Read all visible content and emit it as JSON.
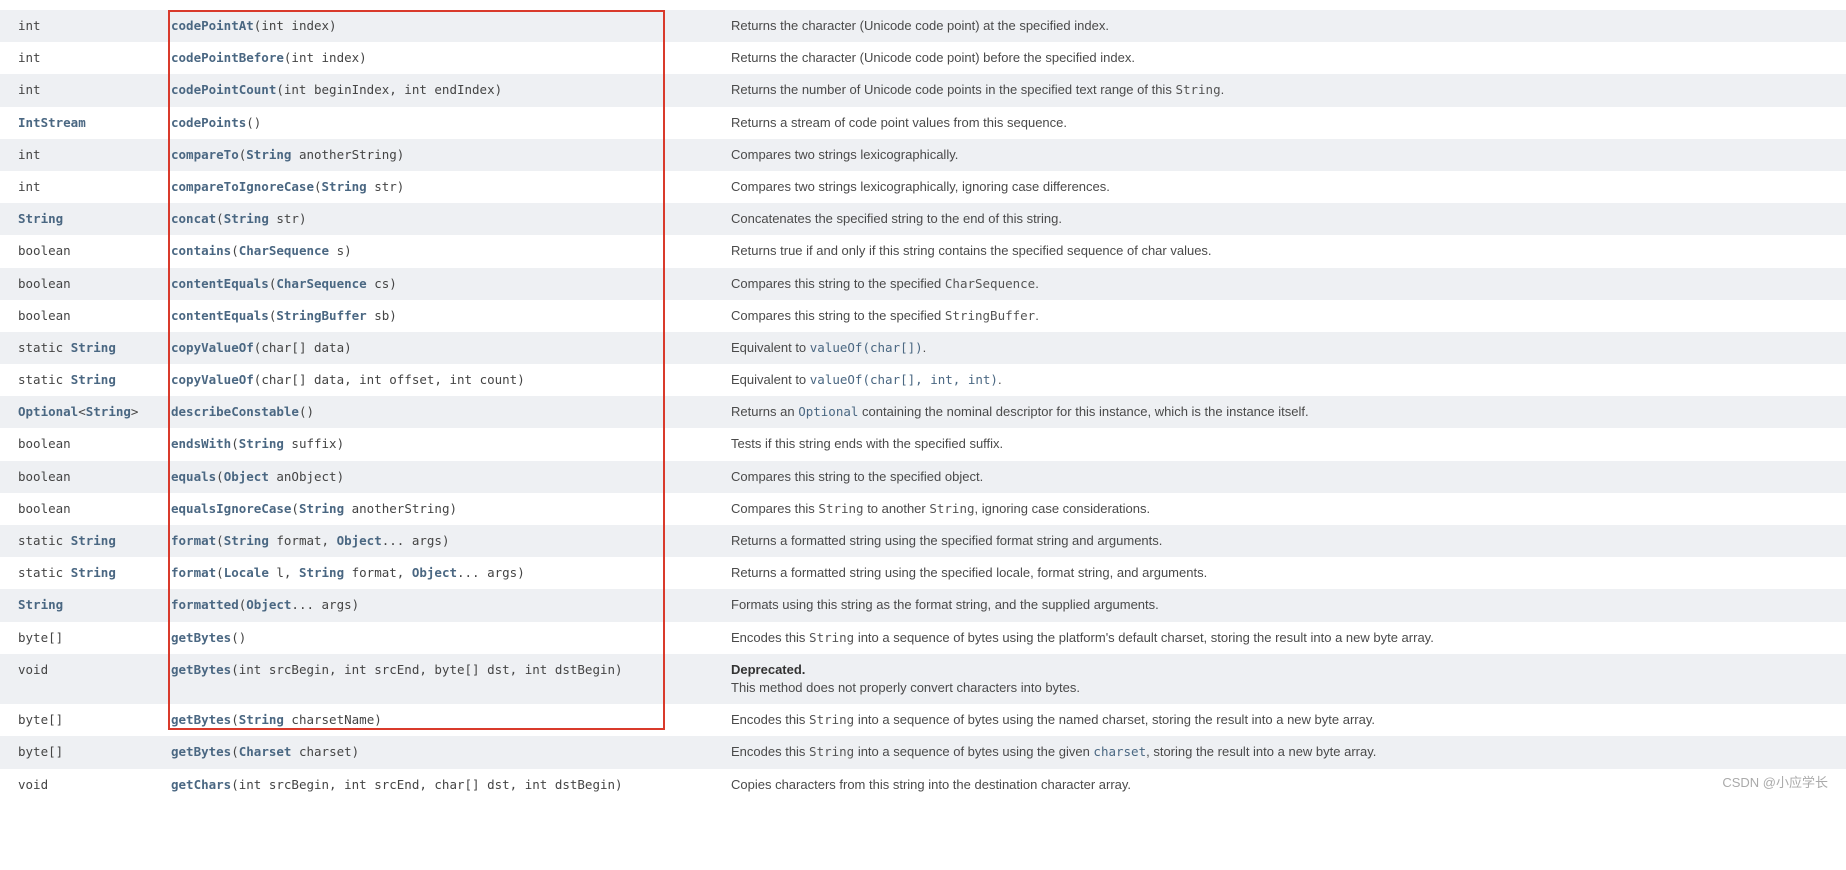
{
  "watermark": "CSDN @小应学长",
  "rows": [
    {
      "type": [
        {
          "t": "int"
        }
      ],
      "method": [
        {
          "l": "codePointAt"
        },
        {
          "t": "(int index)"
        }
      ],
      "desc": [
        {
          "t": "Returns the character (Unicode code point) at the specified index."
        }
      ]
    },
    {
      "type": [
        {
          "t": "int"
        }
      ],
      "method": [
        {
          "l": "codePointBefore"
        },
        {
          "t": "(int index)"
        }
      ],
      "desc": [
        {
          "t": "Returns the character (Unicode code point) before the specified index."
        }
      ]
    },
    {
      "type": [
        {
          "t": "int"
        }
      ],
      "method": [
        {
          "l": "codePointCount"
        },
        {
          "t": "(int beginIndex, int endIndex)"
        }
      ],
      "desc": [
        {
          "t": "Returns the number of Unicode code points in the specified text range of this "
        },
        {
          "c": "String"
        },
        {
          "t": "."
        }
      ]
    },
    {
      "type": [
        {
          "l": "IntStream"
        }
      ],
      "method": [
        {
          "l": "codePoints"
        },
        {
          "t": "()"
        }
      ],
      "desc": [
        {
          "t": "Returns a stream of code point values from this sequence."
        }
      ]
    },
    {
      "type": [
        {
          "t": "int"
        }
      ],
      "method": [
        {
          "l": "compareTo"
        },
        {
          "t": "("
        },
        {
          "l": "String"
        },
        {
          "t": " anotherString)"
        }
      ],
      "desc": [
        {
          "t": "Compares two strings lexicographically."
        }
      ]
    },
    {
      "type": [
        {
          "t": "int"
        }
      ],
      "method": [
        {
          "l": "compareToIgnoreCase"
        },
        {
          "t": "("
        },
        {
          "l": "String"
        },
        {
          "t": " str)"
        }
      ],
      "desc": [
        {
          "t": "Compares two strings lexicographically, ignoring case differences."
        }
      ]
    },
    {
      "type": [
        {
          "l": "String"
        }
      ],
      "method": [
        {
          "l": "concat"
        },
        {
          "t": "("
        },
        {
          "l": "String"
        },
        {
          "t": " str)"
        }
      ],
      "desc": [
        {
          "t": "Concatenates the specified string to the end of this string."
        }
      ]
    },
    {
      "type": [
        {
          "t": "boolean"
        }
      ],
      "method": [
        {
          "l": "contains"
        },
        {
          "t": "("
        },
        {
          "l": "CharSequence"
        },
        {
          "t": " s)"
        }
      ],
      "desc": [
        {
          "t": "Returns true if and only if this string contains the specified sequence of char values."
        }
      ]
    },
    {
      "type": [
        {
          "t": "boolean"
        }
      ],
      "method": [
        {
          "l": "contentEquals"
        },
        {
          "t": "("
        },
        {
          "l": "CharSequence"
        },
        {
          "t": " cs)"
        }
      ],
      "desc": [
        {
          "t": "Compares this string to the specified "
        },
        {
          "c": "CharSequence"
        },
        {
          "t": "."
        }
      ]
    },
    {
      "type": [
        {
          "t": "boolean"
        }
      ],
      "method": [
        {
          "l": "contentEquals"
        },
        {
          "t": "("
        },
        {
          "l": "StringBuffer"
        },
        {
          "t": " sb)"
        }
      ],
      "desc": [
        {
          "t": "Compares this string to the specified "
        },
        {
          "c": "StringBuffer"
        },
        {
          "t": "."
        }
      ]
    },
    {
      "type": [
        {
          "t": "static "
        },
        {
          "l": "String"
        }
      ],
      "method": [
        {
          "l": "copyValueOf"
        },
        {
          "t": "(char[] data)"
        }
      ],
      "desc": [
        {
          "t": "Equivalent to "
        },
        {
          "a": "valueOf(char[])"
        },
        {
          "t": "."
        }
      ]
    },
    {
      "type": [
        {
          "t": "static "
        },
        {
          "l": "String"
        }
      ],
      "method": [
        {
          "l": "copyValueOf"
        },
        {
          "t": "(char[] data, int offset, int count)"
        }
      ],
      "desc": [
        {
          "t": "Equivalent to "
        },
        {
          "a": "valueOf(char[], int, int)"
        },
        {
          "t": "."
        }
      ]
    },
    {
      "type": [
        {
          "l": "Optional"
        },
        {
          "t": "<"
        },
        {
          "l": "String"
        },
        {
          "t": ">"
        }
      ],
      "method": [
        {
          "l": "describeConstable"
        },
        {
          "t": "()"
        }
      ],
      "desc": [
        {
          "t": "Returns an "
        },
        {
          "a": "Optional"
        },
        {
          "t": " containing the nominal descriptor for this instance, which is the instance itself."
        }
      ]
    },
    {
      "type": [
        {
          "t": "boolean"
        }
      ],
      "method": [
        {
          "l": "endsWith"
        },
        {
          "t": "("
        },
        {
          "l": "String"
        },
        {
          "t": " suffix)"
        }
      ],
      "desc": [
        {
          "t": "Tests if this string ends with the specified suffix."
        }
      ]
    },
    {
      "type": [
        {
          "t": "boolean"
        }
      ],
      "method": [
        {
          "l": "equals"
        },
        {
          "t": "("
        },
        {
          "l": "Object"
        },
        {
          "t": " anObject)"
        }
      ],
      "desc": [
        {
          "t": "Compares this string to the specified object."
        }
      ]
    },
    {
      "type": [
        {
          "t": "boolean"
        }
      ],
      "method": [
        {
          "l": "equalsIgnoreCase"
        },
        {
          "t": "("
        },
        {
          "l": "String"
        },
        {
          "t": " anotherString)"
        }
      ],
      "desc": [
        {
          "t": "Compares this "
        },
        {
          "c": "String"
        },
        {
          "t": " to another "
        },
        {
          "c": "String"
        },
        {
          "t": ", ignoring case considerations."
        }
      ]
    },
    {
      "type": [
        {
          "t": "static "
        },
        {
          "l": "String"
        }
      ],
      "method": [
        {
          "l": "format"
        },
        {
          "t": "("
        },
        {
          "l": "String"
        },
        {
          "t": " format, "
        },
        {
          "l": "Object"
        },
        {
          "t": "... args)"
        }
      ],
      "desc": [
        {
          "t": "Returns a formatted string using the specified format string and arguments."
        }
      ]
    },
    {
      "type": [
        {
          "t": "static "
        },
        {
          "l": "String"
        }
      ],
      "method": [
        {
          "l": "format"
        },
        {
          "t": "("
        },
        {
          "l": "Locale"
        },
        {
          "t": " l, "
        },
        {
          "l": "String"
        },
        {
          "t": " format, "
        },
        {
          "l": "Object"
        },
        {
          "t": "... args)"
        }
      ],
      "desc": [
        {
          "t": "Returns a formatted string using the specified locale, format string, and arguments."
        }
      ]
    },
    {
      "type": [
        {
          "l": "String"
        }
      ],
      "method": [
        {
          "l": "formatted"
        },
        {
          "t": "("
        },
        {
          "l": "Object"
        },
        {
          "t": "... args)"
        }
      ],
      "desc": [
        {
          "t": "Formats using this string as the format string, and the supplied arguments."
        }
      ]
    },
    {
      "type": [
        {
          "t": "byte[]"
        }
      ],
      "method": [
        {
          "l": "getBytes"
        },
        {
          "t": "()"
        }
      ],
      "desc": [
        {
          "t": "Encodes this "
        },
        {
          "c": "String"
        },
        {
          "t": " into a sequence of bytes using the platform's default charset, storing the result into a new byte array."
        }
      ]
    },
    {
      "type": [
        {
          "t": "void"
        }
      ],
      "method": [
        {
          "l": "getBytes"
        },
        {
          "t": "(int srcBegin, int srcEnd, byte[] dst, int dstBegin)"
        }
      ],
      "desc": [
        {
          "d": "Deprecated."
        },
        {
          "br": true
        },
        {
          "t": "This method does not properly convert characters into bytes."
        }
      ]
    },
    {
      "type": [
        {
          "t": "byte[]"
        }
      ],
      "method": [
        {
          "l": "getBytes"
        },
        {
          "t": "("
        },
        {
          "l": "String"
        },
        {
          "t": " charsetName)"
        }
      ],
      "desc": [
        {
          "t": "Encodes this "
        },
        {
          "c": "String"
        },
        {
          "t": " into a sequence of bytes using the named charset, storing the result into a new byte array."
        }
      ]
    },
    {
      "type": [
        {
          "t": "byte[]"
        }
      ],
      "method": [
        {
          "l": "getBytes"
        },
        {
          "t": "("
        },
        {
          "l": "Charset"
        },
        {
          "t": " charset)"
        }
      ],
      "desc": [
        {
          "t": "Encodes this "
        },
        {
          "c": "String"
        },
        {
          "t": " into a sequence of bytes using the given "
        },
        {
          "a": "charset"
        },
        {
          "t": ", storing the result into a new byte array."
        }
      ]
    },
    {
      "type": [
        {
          "t": "void"
        }
      ],
      "method": [
        {
          "l": "getChars"
        },
        {
          "t": "(int srcBegin, int srcEnd, char[] dst, int dstBegin)"
        }
      ],
      "desc": [
        {
          "t": "Copies characters from this string into the destination character array."
        }
      ]
    }
  ]
}
